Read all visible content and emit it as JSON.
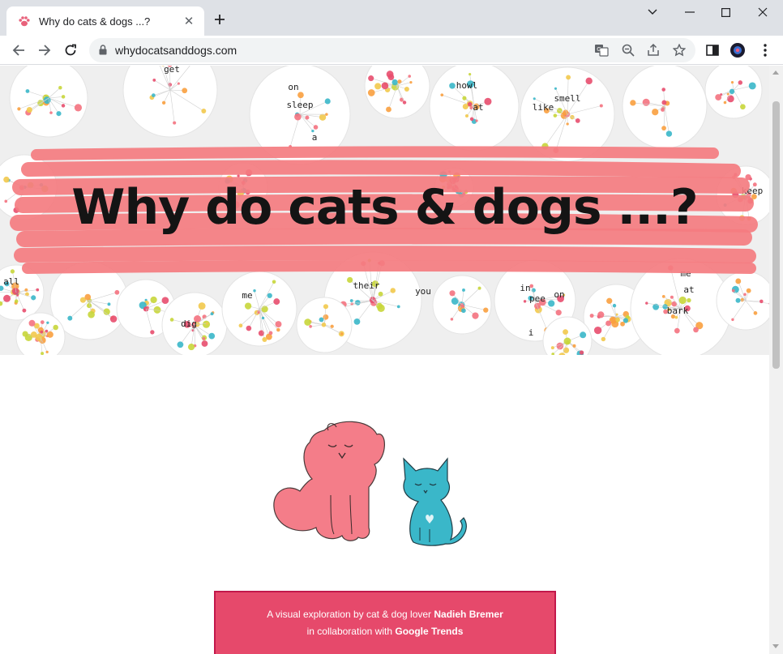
{
  "browser": {
    "tab_title": "Why do cats & dogs ...?",
    "url": "whydocatsanddogs.com",
    "accent": "#dee1e6"
  },
  "hero": {
    "title": "Why do cats & dogs ...?",
    "brush_color": "#f47c80",
    "bubble_words": [
      "get",
      "on",
      "sleep",
      "a",
      "howl",
      "at",
      "smell",
      "keep",
      "all",
      "dig",
      "me",
      "their",
      "you",
      "pee",
      "on",
      "me",
      "at",
      "bark",
      "like",
      "in",
      "i"
    ],
    "dot_colors": [
      "#f4727f",
      "#3ab7c9",
      "#f9a03f",
      "#c8d63a",
      "#e84e6e",
      "#f2c94c"
    ]
  },
  "credit": {
    "line1_prefix": "A visual exploration by cat & dog lover",
    "line1_name": "Nadieh Bremer",
    "line2_prefix": "in collaboration with",
    "line2_name": "Google Trends",
    "background": "#e6496b"
  }
}
